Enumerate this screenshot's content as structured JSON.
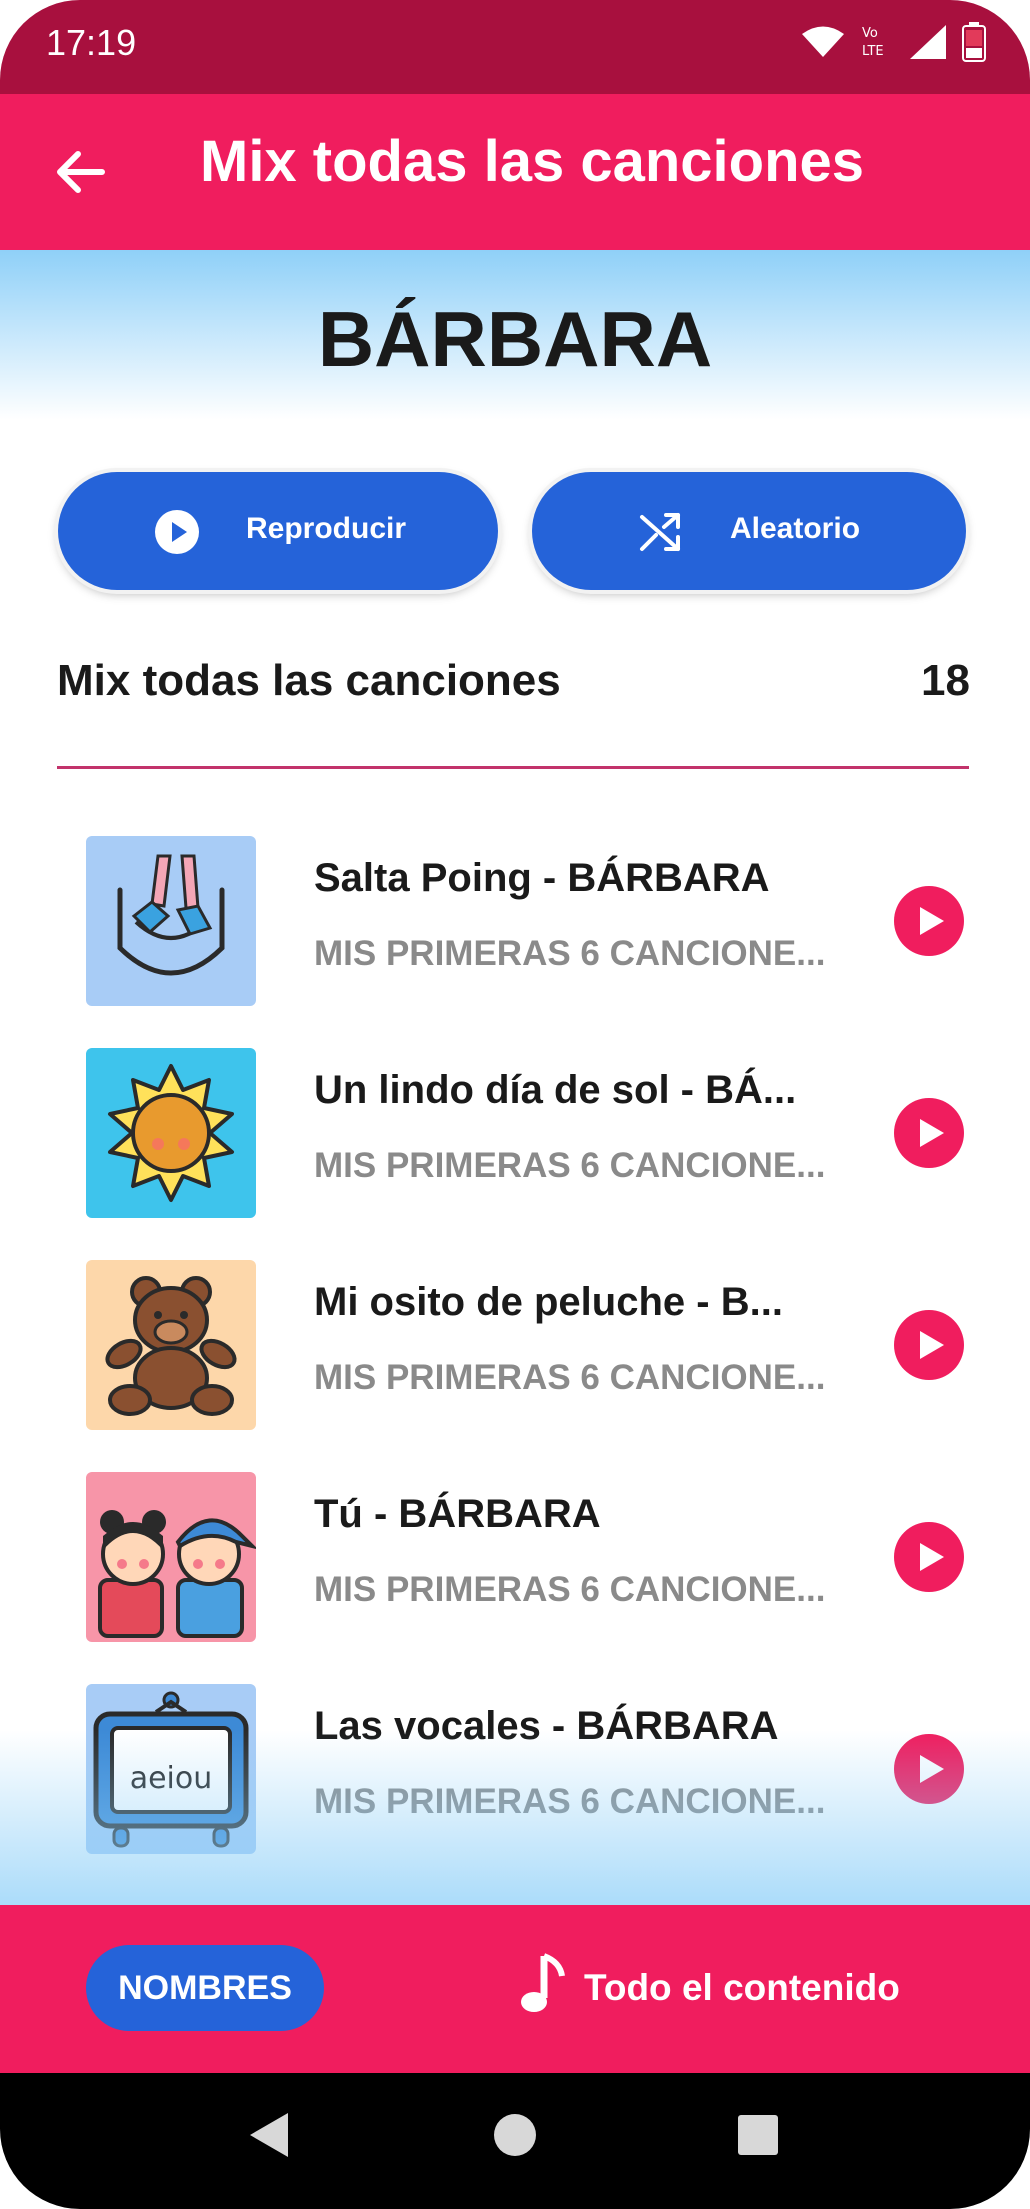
{
  "status_bar": {
    "time": "17:19",
    "icons": [
      "wifi-icon",
      "volte-icon",
      "signal-icon",
      "battery-icon"
    ]
  },
  "app_bar": {
    "title": "Mix todas las canciones",
    "back_icon": "arrow-left-icon"
  },
  "hero": {
    "name": "BÁRBARA"
  },
  "actions": {
    "play_label": "Reproducir",
    "shuffle_label": "Aleatorio"
  },
  "section": {
    "title": "Mix todas las canciones",
    "count": "18"
  },
  "songs": [
    {
      "title": "Salta Poing - BÁRBARA",
      "album": "MIS PRIMERAS 6 CANCIONE...",
      "thumb_icon": "jumping-feet-icon",
      "thumb_color": "#a8ccf6"
    },
    {
      "title": "Un lindo día de sol - BÁ...",
      "album": "MIS PRIMERAS 6 CANCIONE...",
      "thumb_icon": "sun-icon",
      "thumb_color": "#3ec4ec"
    },
    {
      "title": "Mi osito de peluche - B...",
      "album": "MIS PRIMERAS 6 CANCIONE...",
      "thumb_icon": "teddy-bear-icon",
      "thumb_color": "#fdd7aa"
    },
    {
      "title": "Tú - BÁRBARA",
      "album": "MIS PRIMERAS 6 CANCIONE...",
      "thumb_icon": "kids-icon",
      "thumb_color": "#f795a8"
    },
    {
      "title": "Las vocales - BÁRBARA",
      "album": "MIS PRIMERAS 6 CANCIONE...",
      "thumb_icon": "vowels-tv-icon",
      "thumb_color": "#a8ccf6",
      "thumb_text": "aeiou"
    }
  ],
  "bottom_nav": {
    "names_label": "NOMBRES",
    "all_content_label": "Todo el contenido"
  },
  "colors": {
    "accent": "#f01d5e",
    "status_bar": "#a8103e",
    "primary_blue": "#2563d9"
  }
}
